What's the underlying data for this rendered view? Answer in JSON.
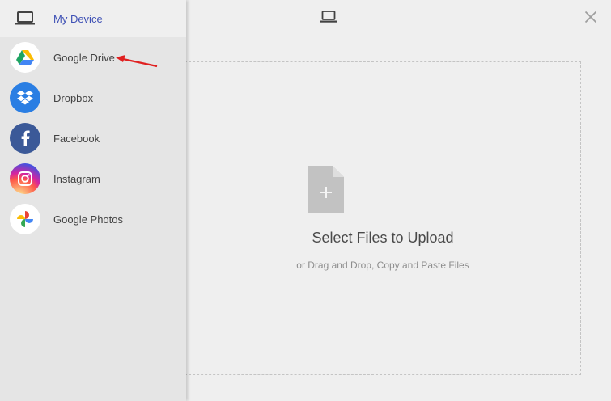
{
  "sidebar": {
    "items": [
      {
        "label": "My Device",
        "icon": "laptop-icon"
      },
      {
        "label": "Google Drive",
        "icon": "google-drive-icon"
      },
      {
        "label": "Dropbox",
        "icon": "dropbox-icon"
      },
      {
        "label": "Facebook",
        "icon": "facebook-icon"
      },
      {
        "label": "Instagram",
        "icon": "instagram-icon"
      },
      {
        "label": "Google Photos",
        "icon": "google-photos-icon"
      }
    ]
  },
  "main": {
    "header_icon": "laptop-icon",
    "close_icon": "close-icon",
    "dropzone": {
      "title": "Select Files to Upload",
      "subtitle": "or Drag and Drop, Copy and Paste Files",
      "icon": "add-file-icon"
    }
  },
  "colors": {
    "accent": "#3f51b5",
    "annotation": "#e02020",
    "dropbox": "#2a7ee3",
    "facebook": "#3b5998"
  }
}
